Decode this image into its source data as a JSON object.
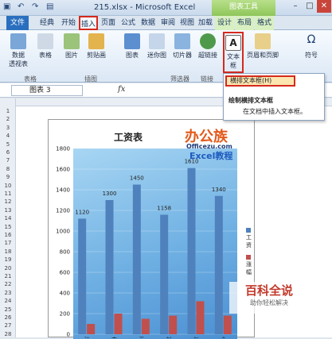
{
  "titlebar": {
    "title": "215.xlsx - Microsoft Excel",
    "context_tools": "图表工具"
  },
  "tabs": [
    {
      "label": "文件"
    },
    {
      "label": "经典"
    },
    {
      "label": "开始"
    },
    {
      "label": "插入"
    },
    {
      "label": "页面"
    },
    {
      "label": "公式"
    },
    {
      "label": "数据"
    },
    {
      "label": "审阅"
    },
    {
      "label": "视图"
    },
    {
      "label": "加载"
    },
    {
      "label": "设计"
    },
    {
      "label": "布局"
    },
    {
      "label": "格式"
    }
  ],
  "ribbon": {
    "buttons": [
      {
        "label": "数据\n透视表"
      },
      {
        "label": "表格"
      },
      {
        "label": "图片"
      },
      {
        "label": "剪贴画"
      },
      {
        "label": "图表"
      },
      {
        "label": "迷你图"
      },
      {
        "label": "切片器"
      },
      {
        "label": "超链接"
      },
      {
        "label": "文本框"
      },
      {
        "label": "页眉和页脚"
      },
      {
        "label": "符号"
      }
    ],
    "groups": [
      "表格",
      "插图",
      "筛选器",
      "链接"
    ]
  },
  "formula_bar": {
    "name_box": "图表 3",
    "fx": "fx"
  },
  "dropdown": {
    "item1": "横排文本框(H)",
    "item2": "绘制横排文本框",
    "item3": "在文档中插入文本框。"
  },
  "row_numbers": [
    "1",
    "2",
    "3",
    "4",
    "5",
    "6",
    "7",
    "8",
    "9",
    "10",
    "11",
    "12",
    "13",
    "14",
    "15",
    "16",
    "17",
    "18",
    "19",
    "20",
    "21",
    "22",
    "23",
    "24",
    "25",
    "26",
    "27",
    "28"
  ],
  "watermarks": {
    "brand_main": "办公族",
    "brand_url": "Officezu.com",
    "brand_sub": "Excel教程",
    "corner_main": "百科全说",
    "corner_sub": "助你轻松解决"
  },
  "chart_data": {
    "type": "bar",
    "title": "工资表",
    "categories": [
      "张",
      "李",
      "王",
      "刘",
      "赵",
      "金"
    ],
    "series": [
      {
        "name": "工资",
        "values": [
          1120,
          1300,
          1450,
          1158,
          1610,
          1340
        ],
        "color": "#4f81bd"
      },
      {
        "name": "涨幅",
        "values": [
          100,
          200,
          150,
          180,
          320,
          180
        ],
        "color": "#c0504d"
      }
    ],
    "data_labels": [
      "1120",
      "1300",
      "1450",
      "1158",
      "1610",
      "1340"
    ],
    "y_ticks": [
      "1800",
      "1600",
      "1400",
      "1200",
      "1000",
      "800",
      "600",
      "400",
      "200",
      "0"
    ],
    "ylim": [
      0,
      1800
    ],
    "legend_position": "right"
  }
}
